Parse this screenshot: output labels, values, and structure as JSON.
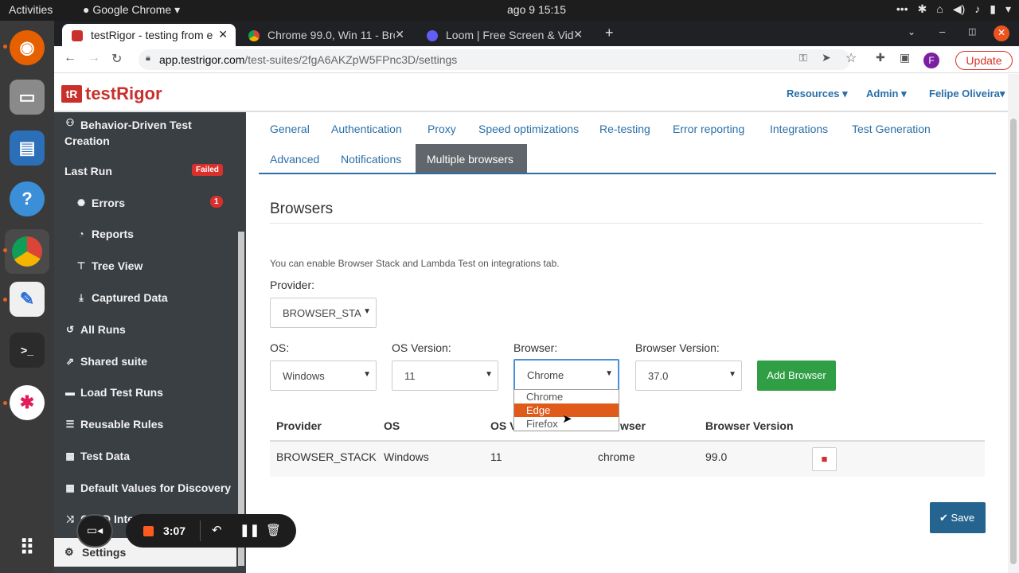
{
  "topbar": {
    "activities": "Activities",
    "app": "Google Chrome",
    "clock": "ago 9  15:15"
  },
  "tabs": [
    {
      "title": "testRigor - testing from e",
      "favicon_color": "#c9302c"
    },
    {
      "title": "Chrome 99.0, Win 11 - Bro",
      "favicon_color": "#f2b400"
    },
    {
      "title": "Loom | Free Screen & Vide",
      "favicon_color": "#625df5"
    }
  ],
  "omnibar": {
    "host": "app.testrigor.com",
    "path": "/test-suites/2fgA6AKZpW5FPnc3D/settings",
    "update": "Update",
    "profile": "F"
  },
  "header": {
    "logo_mark": "tR",
    "logo_text": "testRigor",
    "resources": "Resources",
    "admin": "Admin",
    "user": "Felipe Oliveira"
  },
  "sidebar": {
    "bdd_line1": "Behavior-Driven Test",
    "bdd_line2": "Creation",
    "last_run": "Last Run",
    "last_run_badge": "Failed",
    "errors": "Errors",
    "errors_badge": "1",
    "reports": "Reports",
    "tree_view": "Tree View",
    "captured_data": "Captured Data",
    "all_runs": "All Runs",
    "shared_suite": "Shared suite",
    "load_test_runs": "Load Test Runs",
    "reusable_rules": "Reusable Rules",
    "test_data": "Test Data",
    "default_values": "Default Values for Discovery",
    "ci_integration": "CI/CD Inte",
    "settings": "Settings"
  },
  "settings_tabs": {
    "general": "General",
    "authentication": "Authentication",
    "proxy": "Proxy",
    "speed": "Speed optimizations",
    "retesting": "Re-testing",
    "error_reporting": "Error reporting",
    "integrations": "Integrations",
    "test_generation": "Test Generation",
    "advanced": "Advanced",
    "notifications": "Notifications",
    "multiple_browsers": "Multiple browsers"
  },
  "browsers": {
    "title": "Browsers",
    "info": "You can enable Browser Stack and Lambda Test on integrations tab.",
    "provider_label": "Provider:",
    "provider_value": "BROWSER_STA",
    "os_label": "OS:",
    "os_value": "Windows",
    "os_version_label": "OS Version:",
    "os_version_value": "11",
    "browser_label": "Browser:",
    "browser_value": "Chrome",
    "browser_version_label": "Browser Version:",
    "browser_version_value": "37.0",
    "add_button": "Add Browser",
    "dropdown_options": [
      "Chrome",
      "Edge",
      "Firefox"
    ],
    "dropdown_highlighted": "Edge",
    "table_headers": {
      "provider": "Provider",
      "os": "OS",
      "os_version": "OS V",
      "browser": "wser",
      "browser_version": "Browser Version"
    },
    "rows": [
      {
        "provider": "BROWSER_STACK",
        "os": "Windows",
        "os_version": "11",
        "browser": "chrome",
        "browser_version": "99.0"
      }
    ],
    "save": "Save"
  },
  "recorder": {
    "time": "3:07"
  },
  "colors": {
    "accent": "#2a6fa8",
    "brand": "#c9302c",
    "success": "#2f9e44",
    "highlight": "#e05a1a",
    "save": "#25648f"
  }
}
